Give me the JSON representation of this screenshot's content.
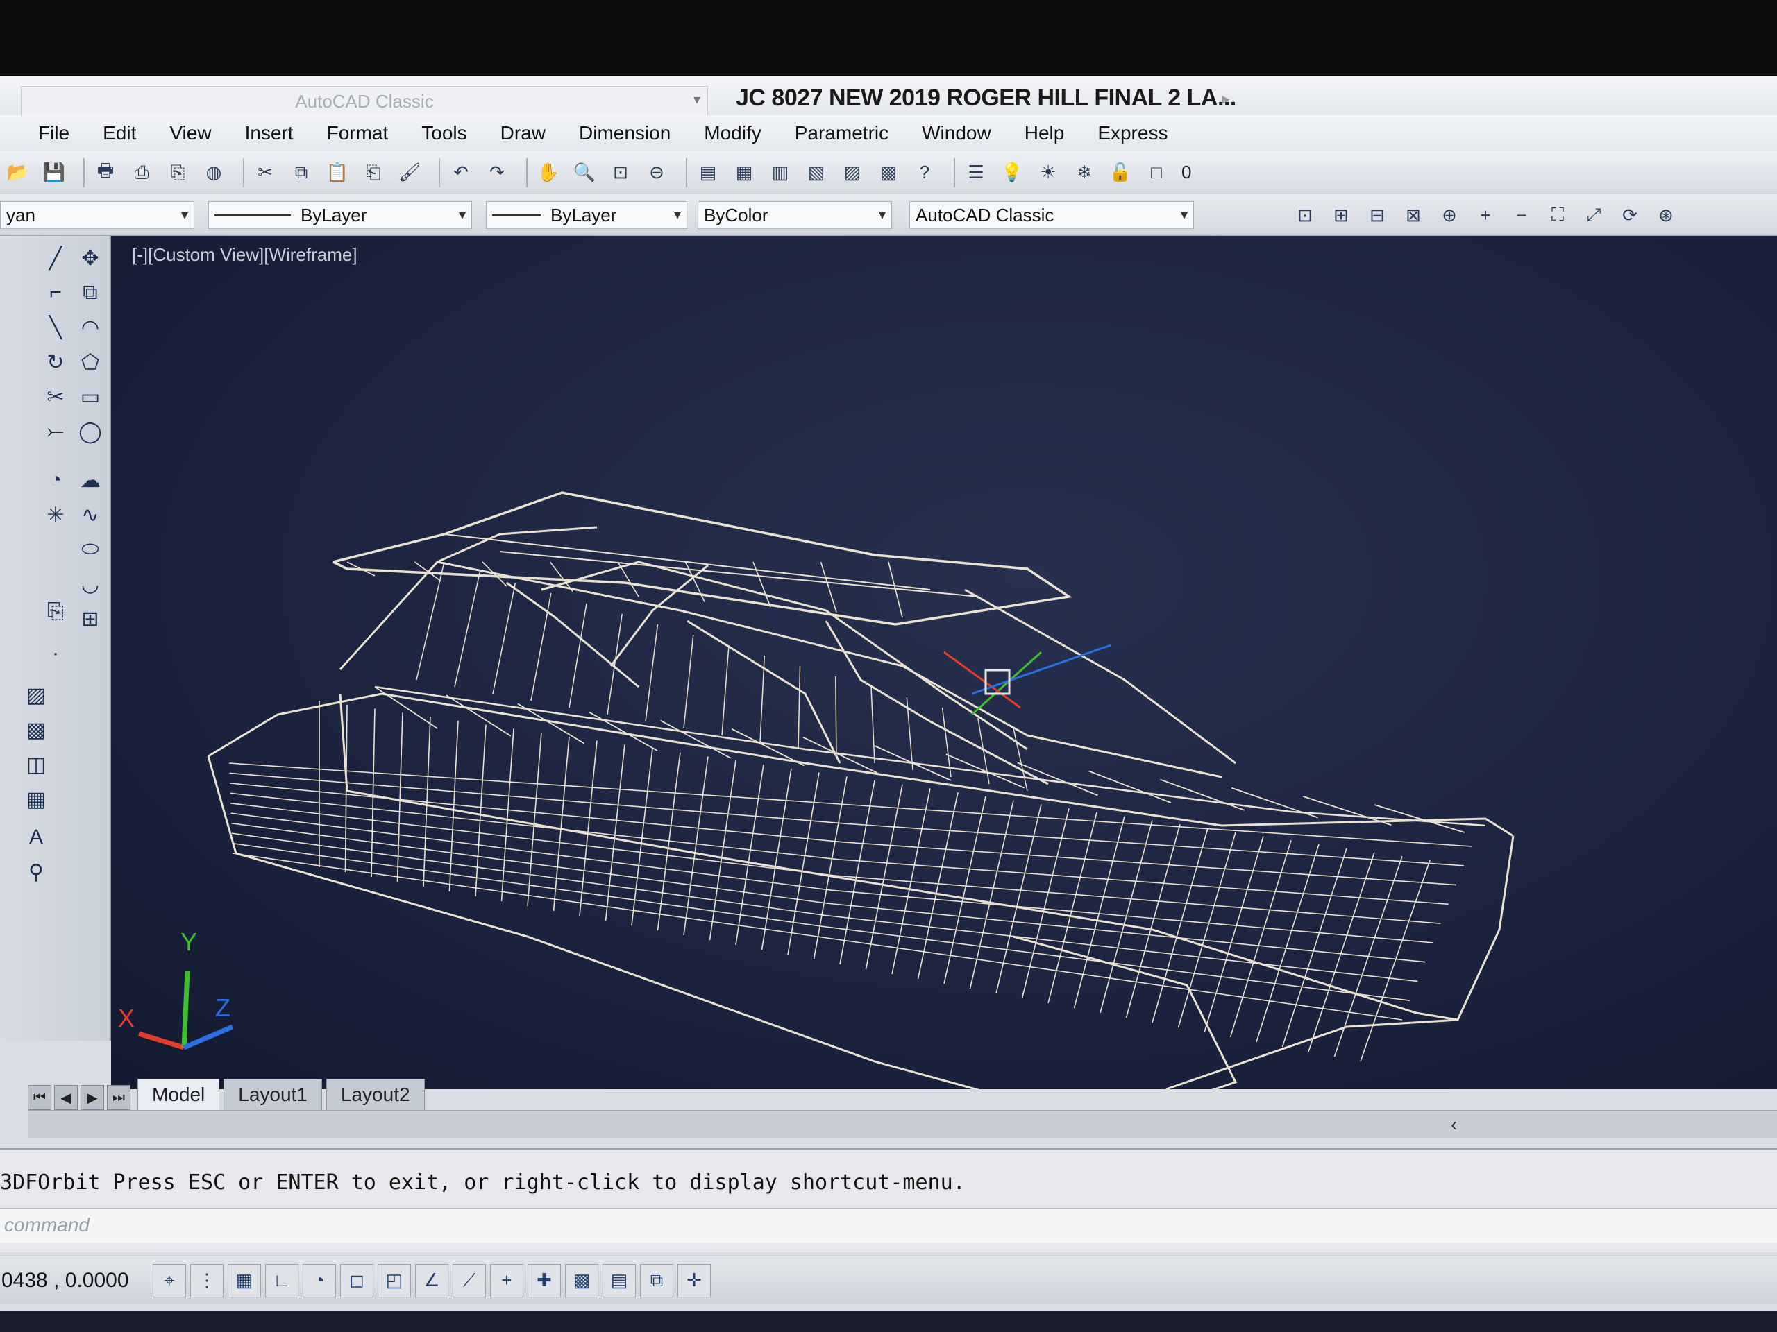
{
  "workspace_combo": "AutoCAD Classic",
  "document_title": "JC 8027 NEW 2019 ROGER HILL FINAL 2 LA...",
  "menu": [
    "File",
    "Edit",
    "View",
    "Insert",
    "Format",
    "Tools",
    "Draw",
    "Dimension",
    "Modify",
    "Parametric",
    "Window",
    "Help",
    "Express"
  ],
  "layer_value": "0",
  "properties": {
    "layer_partial": "yan",
    "linetype": "ByLayer",
    "lineweight": "ByLayer",
    "color": "ByColor",
    "workspace": "AutoCAD Classic"
  },
  "viewport": {
    "label": "[-][Custom View][Wireframe]",
    "ucs": {
      "x": "X",
      "y": "Y",
      "z": "Z"
    },
    "colors": {
      "background": "#1c2440",
      "wire": "#e8e2d0",
      "x_axis": "#e33b2e",
      "y_axis": "#3fbf2f",
      "z_axis": "#2c6fe0"
    }
  },
  "tabs": [
    "Model",
    "Layout1",
    "Layout2"
  ],
  "command": {
    "history": "3DFOrbit Press ESC or ENTER to exit, or right-click to display shortcut-menu.",
    "placeholder": "command"
  },
  "status": {
    "coords": "0438 , 0.0000"
  }
}
